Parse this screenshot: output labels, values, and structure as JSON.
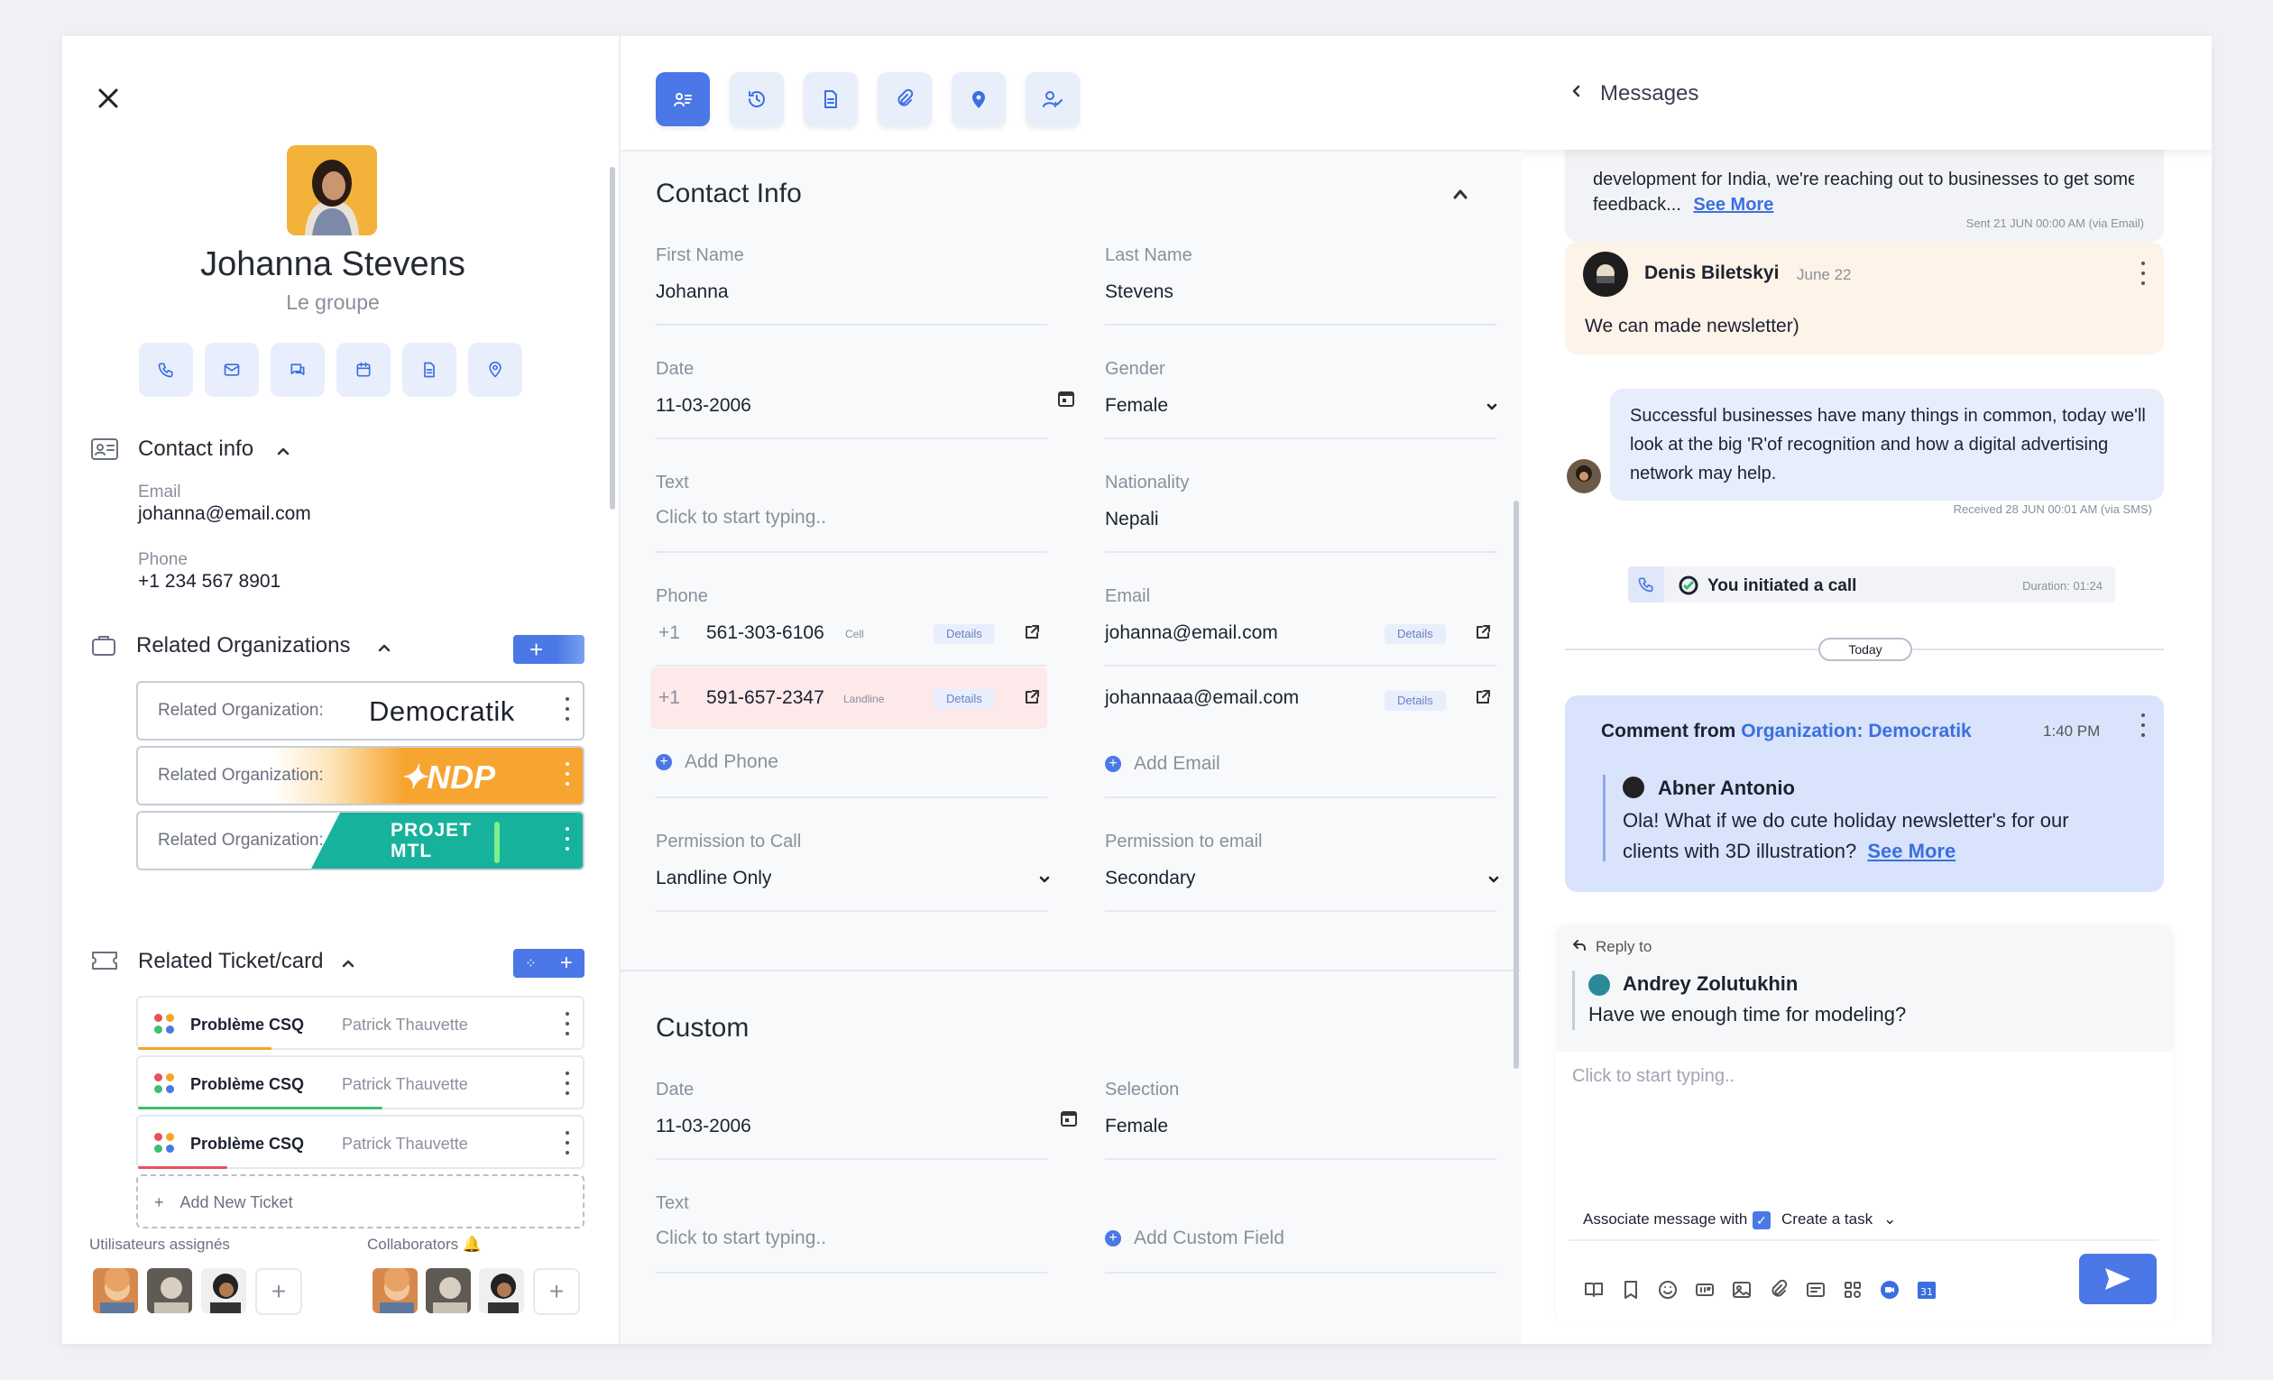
{
  "contact": {
    "name": "Johanna Stevens",
    "group": "Le groupe",
    "section_title": "Contact info",
    "email_label": "Email",
    "email": "johanna@email.com",
    "phone_label": "Phone",
    "phone": "+1 234 567 8901"
  },
  "quick_actions": [
    "phone-icon",
    "mail-icon",
    "chat-icon",
    "calendar-icon",
    "document-icon",
    "location-icon"
  ],
  "organizations": {
    "title": "Related Organizations",
    "items": [
      {
        "label": "Related Organization:",
        "name": "Democratik",
        "color": "#ffffff"
      },
      {
        "label": "Related Organization:",
        "name": "NDP",
        "color": "#f7a531"
      },
      {
        "label": "Related Organization:",
        "name": "PROJET MTL",
        "color": "#17b29b"
      }
    ]
  },
  "tickets": {
    "title": "Related Ticket/card",
    "items": [
      {
        "title": "Problème CSQ",
        "owner": "Patrick Thauvette",
        "bar_color": "#f5a623",
        "progress": 0.3
      },
      {
        "title": "Problème CSQ",
        "owner": "Patrick Thauvette",
        "bar_color": "#3fbf6f",
        "progress": 0.55
      },
      {
        "title": "Problème CSQ",
        "owner": "Patrick Thauvette",
        "bar_color": "#e8505b",
        "progress": 0.2
      }
    ],
    "add_label": "Add New Ticket"
  },
  "assigned": {
    "label": "Utilisateurs assignés",
    "collab_label": "Collaborators"
  },
  "contact_info": {
    "title": "Contact Info",
    "first_name_label": "First Name",
    "first_name": "Johanna",
    "last_name_label": "Last Name",
    "last_name": "Stevens",
    "date_label": "Date",
    "date": "11-03-2006",
    "gender_label": "Gender",
    "gender": "Female",
    "text_label": "Text",
    "text_placeholder": "Click to start typing..",
    "nationality_label": "Nationality",
    "nationality": "Nepali",
    "phone_label": "Phone",
    "phones": [
      {
        "cc": "+1",
        "number": "561-303-6106",
        "type": "Cell",
        "details": "Details"
      },
      {
        "cc": "+1",
        "number": "591-657-2347",
        "type": "Landline",
        "details": "Details"
      }
    ],
    "add_phone": "Add Phone",
    "email_label": "Email",
    "emails": [
      {
        "address": "johanna@email.com",
        "details": "Details"
      },
      {
        "address": "johannaaa@email.com",
        "details": "Details"
      }
    ],
    "add_email": "Add Email",
    "perm_call_label": "Permission to Call",
    "perm_call": "Landline Only",
    "perm_email_label": "Permission to email",
    "perm_email": "Secondary"
  },
  "custom": {
    "title": "Custom",
    "date_label": "Date",
    "date": "11-03-2006",
    "selection_label": "Selection",
    "selection": "Female",
    "text_label": "Text",
    "text_placeholder": "Click to start typing..",
    "add_field": "Add Custom Field"
  },
  "messages": {
    "header": "Messages",
    "m1_text": "feedback...",
    "m1_partial": "development for India, we're reaching out to businesses to get some",
    "m1_more": "See More",
    "m1_stamp": "Sent 21 JUN 00:00 AM (via Email)",
    "m2_author": "Denis Biletskyi",
    "m2_date": "June 22",
    "m2_text": "We can made newsletter)",
    "m3_text": "Successful businesses have many things in common, today we'll look at the big 'R'of recognition and how a digital advertising network may help.",
    "m3_stamp": "Received 28 JUN 00:01 AM (via SMS)",
    "call_text": "You initiated a call",
    "call_duration": "Duration: 01:24",
    "divider": "Today",
    "comment_prefix": "Comment from ",
    "comment_org": "Organization: Democratik",
    "comment_time": "1:40 PM",
    "comment_author": "Abner Antonio",
    "comment_text": "Ola! What if we do cute holiday newsletter's for our clients with 3D illustration?",
    "comment_more": "See More",
    "reply_label": "Reply to",
    "reply_author": "Andrey Zolutukhin",
    "reply_text": "Have we enough time for modeling?",
    "compose_placeholder": "Click to start typing..",
    "associate": "Associate message with",
    "create_task": "Create a task"
  },
  "colors": {
    "accent": "#4b78e6",
    "accent_light": "#e8eefc",
    "comment_bg": "#d9e3fb",
    "m2_bg": "#fdf3e8",
    "m3_bg": "#e8edfb"
  }
}
